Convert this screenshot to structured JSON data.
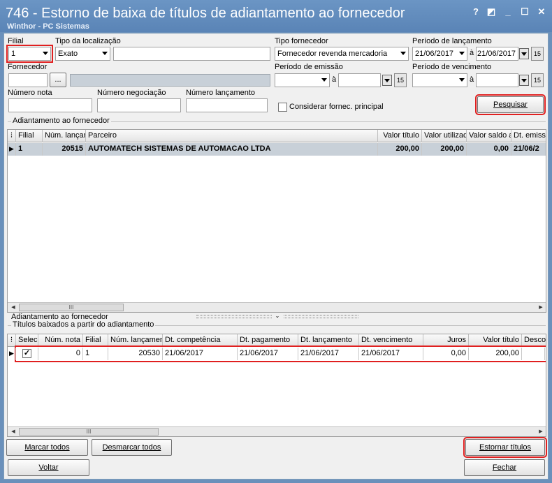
{
  "window": {
    "title": "746 - Estorno de baixa de títulos de adiantamento ao fornecedor",
    "subtitle": "Winthor - PC Sistemas",
    "help_glyph": "?",
    "minimize_glyph": "_",
    "maximize_glyph": "☐",
    "close_glyph": "✕"
  },
  "filters": {
    "filial_label": "Filial",
    "filial_value": "1",
    "tipo_localizacao_label": "Tipo da localização",
    "tipo_localizacao_value": "Exato",
    "tipo_fornecedor_label": "Tipo fornecedor",
    "tipo_fornecedor_value": "Fornecedor revenda mercadoria",
    "periodo_lancamento_label": "Período de lançamento",
    "periodo_lancamento_from": "21/06/2017",
    "periodo_lancamento_sep": "à",
    "periodo_lancamento_to": "21/06/2017",
    "fornecedor_label": "Fornecedor",
    "fornecedor_btn": "...",
    "periodo_emissao_label": "Período de emissão",
    "periodo_emissao_sep": "à",
    "periodo_vencimento_label": "Período de vencimento",
    "periodo_vencimento_sep": "à",
    "numero_nota_label": "Número nota",
    "numero_negociacao_label": "Número negociação",
    "numero_lancamento_label": "Número lançamento",
    "considerar_label": "Considerar fornec. principal",
    "pesquisar_label": "Pesquisar",
    "cal_glyph": "15"
  },
  "adiantamento": {
    "title": "Adiantamento ao fornecedor",
    "columns": [
      "Filial",
      "Núm. lançan",
      "Parceiro",
      "Valor título",
      "Valor utilizad",
      "Valor saldo a",
      "Dt. emissã"
    ],
    "rows": [
      [
        "1",
        "20515",
        "AUTOMATECH SISTEMAS DE AUTOMACAO LTDA",
        "200,00",
        "200,00",
        "0,00",
        "21/06/2"
      ]
    ],
    "section_label": "Adiantamento ao fornecedor"
  },
  "baixados": {
    "title": "Títulos baixados a partir do adiantamento",
    "columns": [
      "Seleci",
      "Núm. nota",
      "Filial",
      "Núm. lançamen",
      "Dt. competência",
      "Dt. pagamento",
      "Dt. lançamento",
      "Dt. vencimento",
      "Juros",
      "Valor título",
      "Descor"
    ],
    "rows": [
      [
        "",
        "0",
        "1",
        "20530",
        "21/06/2017",
        "21/06/2017",
        "21/06/2017",
        "21/06/2017",
        "0,00",
        "200,00",
        ""
      ]
    ]
  },
  "buttons": {
    "marcar_todos": "Marcar todos",
    "desmarcar_todos": "Desmarcar todos",
    "estornar_titulos": "Estornar títulos",
    "voltar": "Voltar",
    "fechar": "Fechar"
  }
}
